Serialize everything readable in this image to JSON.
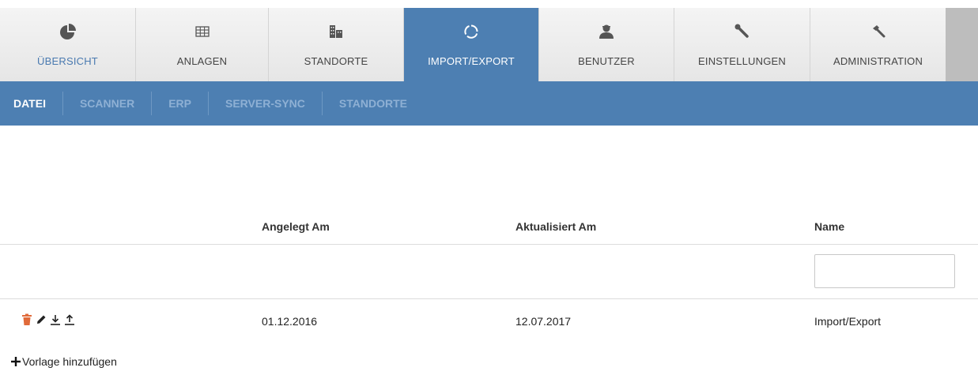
{
  "main_nav": {
    "tabs": [
      {
        "label": "ÜBERSICHT",
        "icon": "pie-chart-icon"
      },
      {
        "label": "ANLAGEN",
        "icon": "grid-table-icon"
      },
      {
        "label": "STANDORTE",
        "icon": "buildings-icon"
      },
      {
        "label": "IMPORT/EXPORT",
        "icon": "sync-circle-icon",
        "active": true
      },
      {
        "label": "BENUTZER",
        "icon": "user-icon"
      },
      {
        "label": "EINSTELLUNGEN",
        "icon": "wrench-icon"
      },
      {
        "label": "ADMINISTRATION",
        "icon": "hammer-icon"
      }
    ]
  },
  "sub_nav": {
    "items": [
      {
        "label": "DATEI",
        "active": true
      },
      {
        "label": "SCANNER"
      },
      {
        "label": "ERP"
      },
      {
        "label": "SERVER-SYNC"
      },
      {
        "label": "STANDORTE"
      }
    ]
  },
  "table": {
    "headers": {
      "created": "Angelegt Am",
      "updated": "Aktualisiert Am",
      "name": "Name"
    },
    "filter": {
      "name_value": "",
      "name_placeholder": ""
    },
    "rows": [
      {
        "created": "01.12.2016",
        "updated": "12.07.2017",
        "name": "Import/Export",
        "actions": [
          "trash-icon",
          "pencil-icon",
          "download-icon",
          "upload-icon"
        ]
      }
    ]
  },
  "add_template_label": "Vorlage hinzufügen",
  "colors": {
    "accent_blue": "#4d7fb2",
    "sub_inactive": "#8eb0d4",
    "delete_orange": "#e06a3a"
  }
}
